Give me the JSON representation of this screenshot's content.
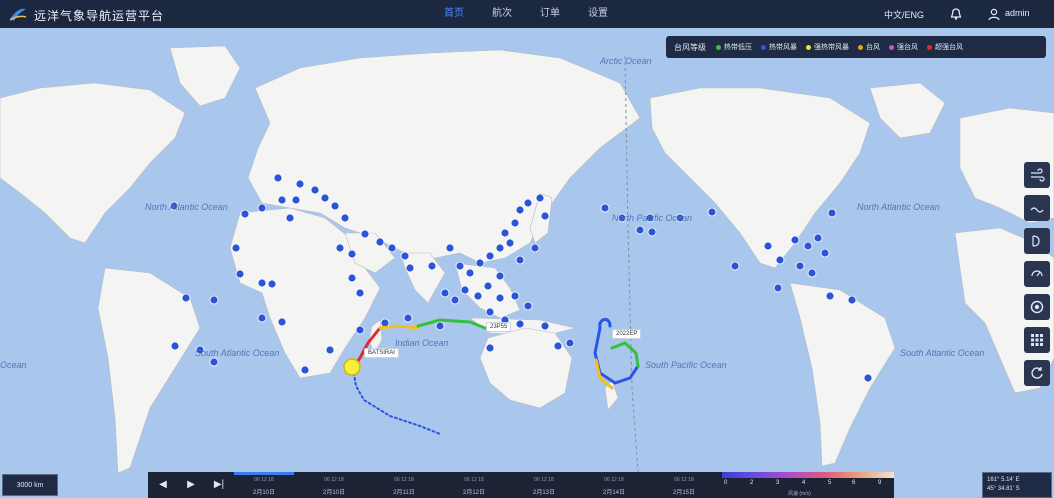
{
  "header": {
    "app_title": "远洋气象导航运营平台",
    "nav": [
      "首页",
      "航次",
      "订单",
      "设置"
    ],
    "active_nav": 0,
    "language": "中文/ENG",
    "username": "admin"
  },
  "legend": {
    "title": "台风等级",
    "items": [
      {
        "label": "热带低压",
        "color": "#35c23a"
      },
      {
        "label": "热带风暴",
        "color": "#2a55e5"
      },
      {
        "label": "强热带风暴",
        "color": "#f0e22a"
      },
      {
        "label": "台风",
        "color": "#f09a22"
      },
      {
        "label": "强台风",
        "color": "#d14fd1"
      },
      {
        "label": "超强台风",
        "color": "#e22b2b"
      }
    ]
  },
  "oceans": [
    {
      "name": "Arctic Ocean"
    },
    {
      "name": "North Atlantic Ocean"
    },
    {
      "name": "North Pacific Ocean"
    },
    {
      "name": "North Atlantic Ocean"
    },
    {
      "name": "Indian Ocean"
    },
    {
      "name": "South Atlantic Ocean"
    },
    {
      "name": "South Pacific Ocean"
    },
    {
      "name": "South Atlantic Ocean"
    },
    {
      "name": "Ocean"
    }
  ],
  "storms": [
    {
      "label": "BATSIRAI"
    },
    {
      "label": "23P55"
    },
    {
      "label": "2022EP"
    }
  ],
  "toolbar": {
    "tools": [
      "wind-icon",
      "wave-icon",
      "current-icon",
      "pressure-icon",
      "target-icon",
      "grid-icon",
      "refresh-icon"
    ]
  },
  "scale": {
    "label": "3000 km"
  },
  "timeline": {
    "dates": [
      "2月10日",
      "2月10日",
      "2月11日",
      "2月12日",
      "2月13日",
      "2月14日",
      "2月15日"
    ],
    "hours": "06  12  18"
  },
  "colorbar": {
    "values": [
      "0",
      "2",
      "3",
      "4",
      "5",
      "6",
      "9"
    ],
    "unit": "风速 (m/s)"
  },
  "coords": {
    "lon": "161° 5.14' E",
    "lat": "45° 34.81' S"
  }
}
